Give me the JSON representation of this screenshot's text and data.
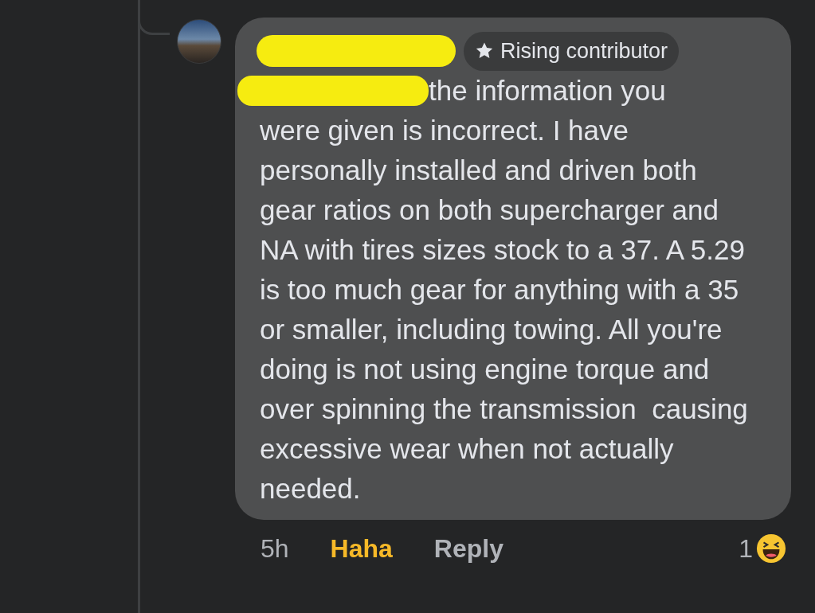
{
  "comment": {
    "badge": "Rising contributor",
    "first_line": "the information you",
    "body": "were given is incorrect. I have personally installed and driven both gear ratios on both supercharger and NA with tires sizes stock to a 37. A 5.29 is too much gear for anything with a 35 or smaller, including towing. All you're doing is not using engine torque and over spinning the transmission  causing excessive wear when not actually needed.",
    "time": "5h",
    "reaction_label": "Haha",
    "reacted": true,
    "reply": "Reply",
    "reaction_count": "1"
  }
}
